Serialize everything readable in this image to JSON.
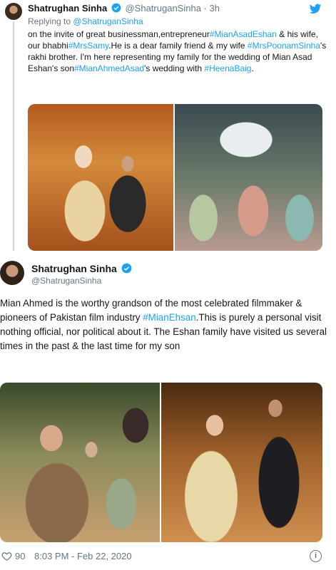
{
  "tweet1": {
    "name": "Shatrughan Sinha",
    "handle": "@ShatruganSinha",
    "dot": "·",
    "time": "3h",
    "replying_label": "Replying to",
    "replying_handle": "@ShatruganSinha",
    "body": [
      {
        "text": "on the invite of great businessman,entrepreneur",
        "tag": false
      },
      {
        "text": "#MianAsadEshan",
        "tag": true
      },
      {
        "text": " & his wife, our bhabhi",
        "tag": false
      },
      {
        "text": "#MrsSamy",
        "tag": true
      },
      {
        "text": ".He is a dear family friend & my wife ",
        "tag": false
      },
      {
        "text": "#MrsPoonamSinha",
        "tag": true
      },
      {
        "text": "'s rakhi brother. I'm here representing my family for the wedding of Mian Asad Eshan's son",
        "tag": false
      },
      {
        "text": "#MianAhmedAsad",
        "tag": true
      },
      {
        "text": "'s wedding with ",
        "tag": false
      },
      {
        "text": "#HeenaBaig",
        "tag": true
      },
      {
        "text": ".",
        "tag": false
      }
    ]
  },
  "tweet2": {
    "name": "Shatrughan Sinha",
    "handle": "@ShatruganSinha",
    "body": [
      {
        "text": "Mian Ahmed is the worthy grandson of the most celebrated filmmaker & pioneers of Pakistan film industry ",
        "tag": false
      },
      {
        "text": "#MianEhsan",
        "tag": true
      },
      {
        "text": ".This is purely a personal visit nothing official, nor political about it. The Eshan family have visited us several times in the past & the last time for my son",
        "tag": false
      }
    ],
    "likes": "90",
    "timestamp": "8:03 PM - Feb 22, 2020",
    "info_icon": "i"
  },
  "colors": {
    "link": "#1da1f2",
    "muted": "#657786",
    "text": "#14171a"
  },
  "icons": [
    "verified-badge-icon",
    "twitter-bird-icon",
    "heart-icon",
    "info-icon"
  ]
}
